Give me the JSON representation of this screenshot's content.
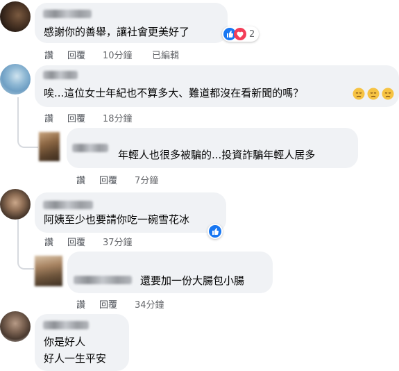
{
  "actions": {
    "like": "讚",
    "reply": "回覆",
    "edited": "已編輯"
  },
  "comments": [
    {
      "text": "感謝你的善舉，讓社會更美好了",
      "time": "10分鐘",
      "reaction_count": "2"
    },
    {
      "text": "唉...這位女士年紀也不算多大、難道都沒在看新聞的嗎？",
      "time": "18分鐘",
      "reply": {
        "text": "年輕人也很多被騙的...投資詐騙年輕人居多",
        "time": "7分鐘"
      }
    },
    {
      "text": "阿姨至少也要請你吃一碗雪花冰",
      "time": "37分鐘",
      "reply": {
        "text": "還要加一份大腸包小腸",
        "time": "34分鐘"
      }
    },
    {
      "text_line1": "你是好人",
      "text_line2": "好人一生平安"
    }
  ],
  "colors": {
    "bubble": "#f0f2f5",
    "like_blue": "#1877f2",
    "love_red": "#f33e58",
    "meta_gray": "#65676b"
  }
}
